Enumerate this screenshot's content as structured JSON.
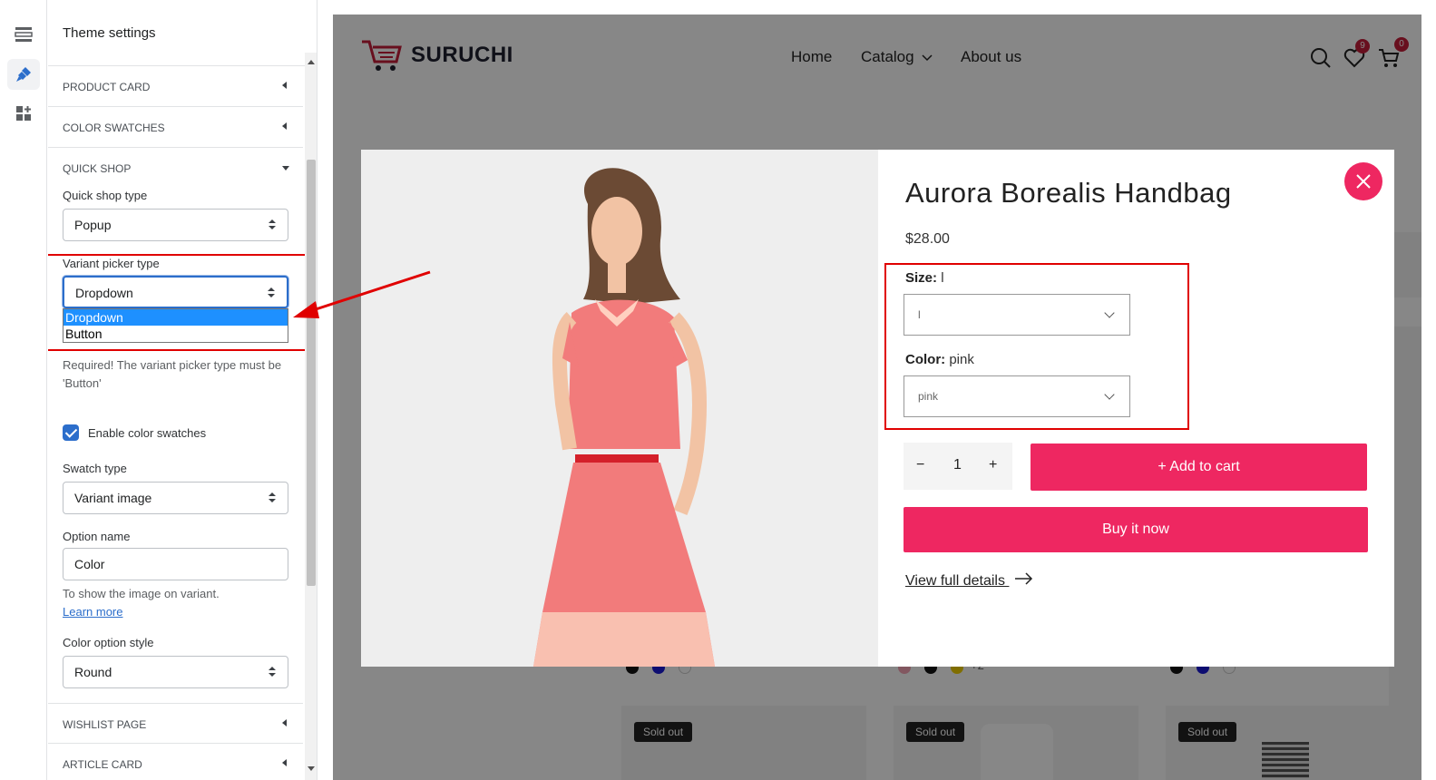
{
  "panel": {
    "title": "Theme settings",
    "sections": {
      "product_card": "PRODUCT CARD",
      "color_swatches": "COLOR SWATCHES",
      "quick_shop": "QUICK SHOP",
      "wishlist_page": "WISHLIST PAGE",
      "article_card": "ARTICLE CARD"
    },
    "quick_shop_type": {
      "label": "Quick shop type",
      "value": "Popup"
    },
    "variant_picker": {
      "label": "Variant picker type",
      "value": "Dropdown",
      "options": [
        "Dropdown",
        "Button"
      ],
      "help": "Required! The variant picker type must be 'Button'"
    },
    "enable_swatches": {
      "label": "Enable color swatches",
      "checked": true
    },
    "swatch_type": {
      "label": "Swatch type",
      "value": "Variant image"
    },
    "option_name": {
      "label": "Option name",
      "value": "Color",
      "help": "To show the image on variant.",
      "link": "Learn more"
    },
    "color_option_style": {
      "label": "Color option style",
      "value": "Round"
    }
  },
  "store": {
    "logo": "SURUCHI",
    "nav": [
      "Home",
      "Catalog",
      "About us"
    ],
    "wishlist_count": "9",
    "cart_count": "0",
    "sold_out_label": "Sold out",
    "bg_text": "+2"
  },
  "modal": {
    "title": "Aurora Borealis Handbag",
    "price": "$28.00",
    "size_label": "Size:",
    "size_value": "l",
    "size_select": "l",
    "color_label": "Color:",
    "color_value": "pink",
    "color_select": "pink",
    "qty_minus": "−",
    "qty": "1",
    "qty_plus": "+",
    "add_to_cart": "+ Add to cart",
    "buy_now": "Buy it now",
    "view_details": "View full details"
  },
  "colors": {
    "accent": "#ee2761",
    "highlight": "#e00000",
    "admin_blue": "#2c6ecb"
  }
}
